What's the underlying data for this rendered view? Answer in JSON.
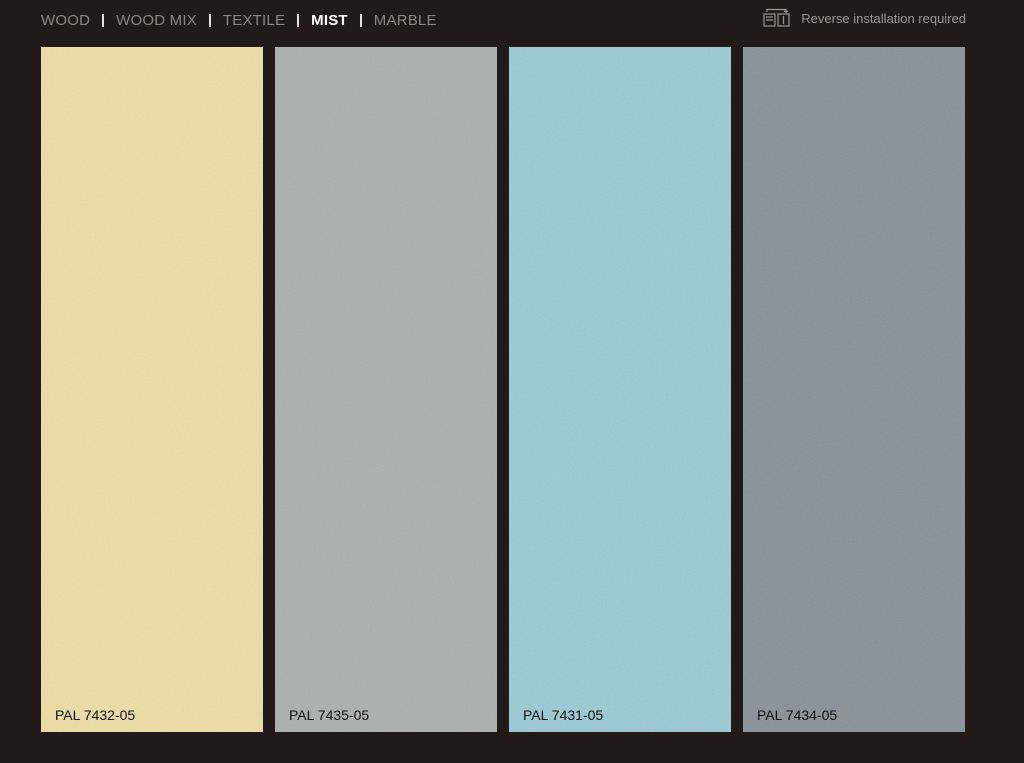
{
  "nav": {
    "items": [
      {
        "label": "WOOD",
        "active": false
      },
      {
        "label": "WOOD MIX",
        "active": false
      },
      {
        "label": "TEXTILE",
        "active": false
      },
      {
        "label": "MIST",
        "active": true
      },
      {
        "label": "MARBLE",
        "active": false
      }
    ]
  },
  "notice": {
    "icon": "reverse-installation-icon",
    "text": "Reverse installation required"
  },
  "swatches": [
    {
      "code": "PAL 7432-05",
      "color": "#efdea3"
    },
    {
      "code": "PAL 7435-05",
      "color": "#a9b1ab"
    },
    {
      "code": "PAL 7431-05",
      "color": "#97cbd6"
    },
    {
      "code": "PAL 7434-05",
      "color": "#868f97"
    }
  ],
  "colors": {
    "background": "#221a19",
    "nav_inactive": "#8e8582",
    "nav_active": "#ffffff",
    "separator": "#e8e2df"
  }
}
